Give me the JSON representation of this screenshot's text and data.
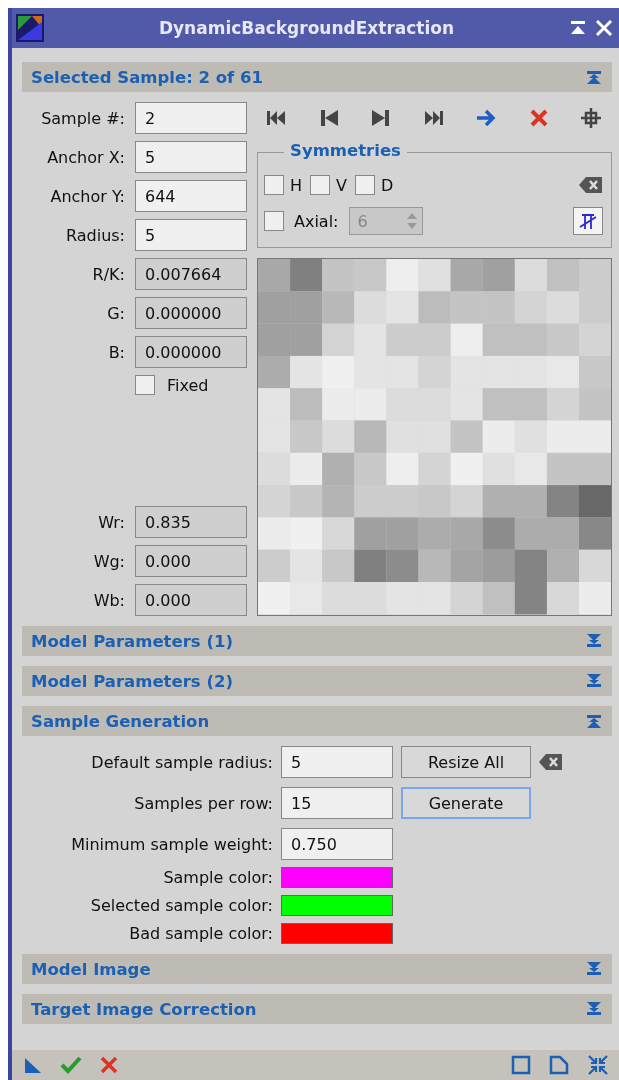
{
  "window": {
    "title": "DynamicBackgroundExtraction"
  },
  "sections": [
    {
      "title": "Selected Sample: 2 of 61",
      "expanded": true,
      "kind": "selected_sample"
    },
    {
      "title": "Model Parameters (1)",
      "expanded": false,
      "kind": "plain"
    },
    {
      "title": "Model Parameters (2)",
      "expanded": false,
      "kind": "plain"
    },
    {
      "title": "Sample Generation",
      "expanded": true,
      "kind": "sample_generation"
    },
    {
      "title": "Model Image",
      "expanded": false,
      "kind": "plain"
    },
    {
      "title": "Target Image Correction",
      "expanded": false,
      "kind": "plain"
    }
  ],
  "selected_sample": {
    "fields": [
      {
        "label": "Sample #:",
        "value": "2"
      },
      {
        "label": "Anchor X:",
        "value": "5"
      },
      {
        "label": "Anchor Y:",
        "value": "644"
      },
      {
        "label": "Radius:",
        "value": "5"
      }
    ],
    "symmetries": {
      "title": "Symmetries",
      "options": [
        {
          "label": "H",
          "checked": false
        },
        {
          "label": "V",
          "checked": false
        },
        {
          "label": "D",
          "checked": false
        }
      ],
      "axial": {
        "label": "Axial:",
        "checked": false,
        "value": "6",
        "disabled": true
      }
    },
    "readouts": [
      {
        "label": "R/K:",
        "value": "0.007664"
      },
      {
        "label": "G:",
        "value": "0.000000"
      },
      {
        "label": "B:",
        "value": "0.000000"
      }
    ],
    "fixed": {
      "label": "Fixed",
      "checked": false
    },
    "weights": [
      {
        "label": "Wr:",
        "value": "0.835"
      },
      {
        "label": "Wg:",
        "value": "0.000"
      },
      {
        "label": "Wb:",
        "value": "0.000"
      }
    ]
  },
  "sample_generation": {
    "rows": [
      {
        "label": "Default sample radius:",
        "value": "5",
        "button": "Resize All",
        "focused": false,
        "clear": true
      },
      {
        "label": "Samples per row:",
        "value": "15",
        "button": "Generate",
        "focused": true,
        "clear": false
      },
      {
        "label": "Minimum sample weight:",
        "value": "0.750",
        "clear": false
      }
    ],
    "colors": [
      {
        "label": "Sample color:",
        "color": "#ff00ff"
      },
      {
        "label": "Selected sample color:",
        "color": "#00ff00"
      },
      {
        "label": "Bad sample color:",
        "color": "#ff0000"
      }
    ]
  }
}
